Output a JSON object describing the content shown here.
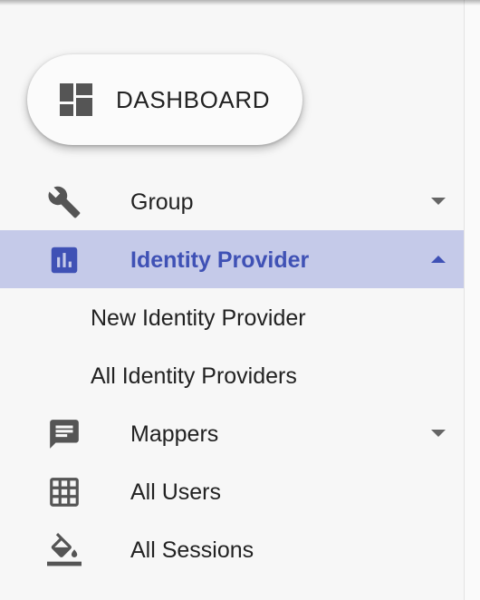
{
  "dashboard": {
    "label": "DASHBOARD",
    "icon": "dashboard-icon"
  },
  "menu": {
    "group": {
      "label": "Group",
      "icon": "wrench-icon",
      "expanded": false
    },
    "identity_provider": {
      "label": "Identity Provider",
      "icon": "bar-chart-icon",
      "expanded": true,
      "active": true,
      "children": [
        {
          "label": "New Identity Provider"
        },
        {
          "label": "All Identity Providers"
        }
      ]
    },
    "mappers": {
      "label": "Mappers",
      "icon": "message-icon",
      "expanded": false
    },
    "all_users": {
      "label": "All Users",
      "icon": "grid-icon"
    },
    "all_sessions": {
      "label": "All Sessions",
      "icon": "paint-bucket-icon"
    }
  },
  "colors": {
    "active_background": "#c5cae9",
    "active_text": "#3f51b5",
    "icon_gray": "#555555"
  }
}
